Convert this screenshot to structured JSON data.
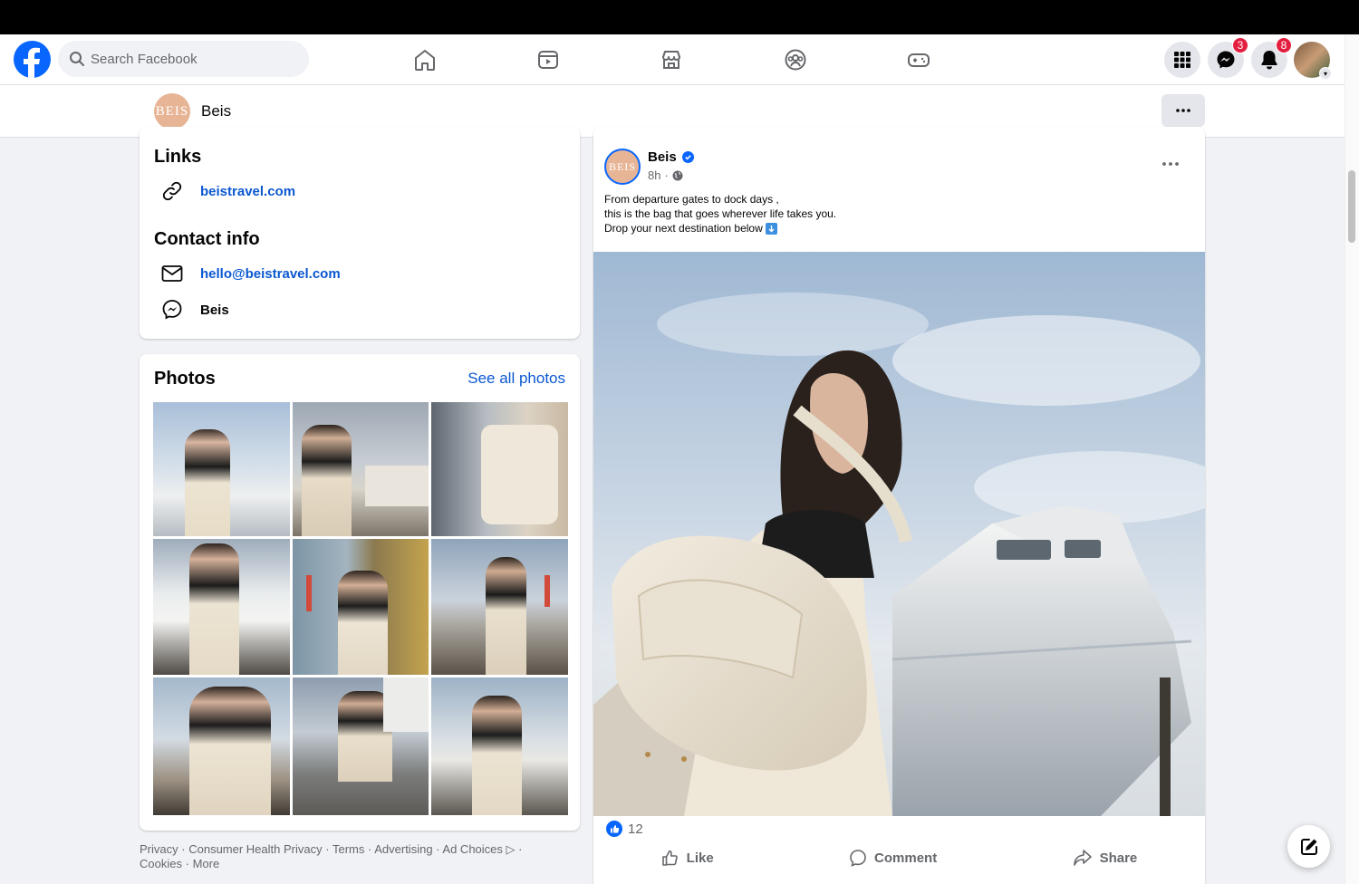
{
  "nav": {
    "search_placeholder": "Search Facebook",
    "messenger_badge": "3",
    "notifications_badge": "8"
  },
  "page": {
    "avatar_text": "BEIS",
    "name": "Beis"
  },
  "links_section": {
    "title": "Links",
    "website": "beistravel.com"
  },
  "contact_section": {
    "title": "Contact info",
    "email": "hello@beistravel.com",
    "messenger": "Beis"
  },
  "photos_section": {
    "title": "Photos",
    "see_all": "See all photos"
  },
  "footer": {
    "privacy": "Privacy",
    "consumer_health": "Consumer Health Privacy",
    "terms": "Terms",
    "advertising": "Advertising",
    "ad_choices": "Ad Choices",
    "cookies": "Cookies",
    "more": "More",
    "sep": "·"
  },
  "post": {
    "author": "Beis",
    "avatar_text": "BEIS",
    "time": "8h",
    "meta_sep": "·",
    "line1": "From departure gates to dock days ,",
    "line2": "this is the bag that goes wherever life takes you.",
    "line3": "Drop your next destination below",
    "reaction_count": "12",
    "like_label": "Like",
    "comment_label": "Comment",
    "share_label": "Share"
  },
  "colors": {
    "brand_blue": "#0866ff",
    "link_blue": "#0a58d1",
    "badge_red": "#e41e3f"
  }
}
